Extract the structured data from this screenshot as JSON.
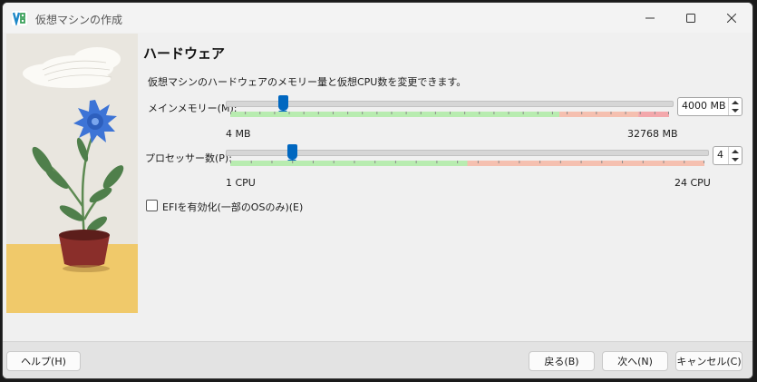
{
  "window": {
    "title": "仮想マシンの作成"
  },
  "page": {
    "heading": "ハードウェア",
    "description": "仮想マシンのハードウェアのメモリー量と仮想CPU数を変更できます。"
  },
  "memory": {
    "label": "メインメモリー(M):",
    "value": "4000 MB",
    "min_label": "4 MB",
    "max_label": "32768 MB",
    "fraction": 0.12,
    "green_fraction": 0.75,
    "salmon_fraction": 0.18,
    "pink_fraction": 0.07
  },
  "cpu": {
    "label": "プロセッサー数(P):",
    "value": "4",
    "min_label": "1 CPU",
    "max_label": "24 CPU",
    "fraction": 0.13,
    "green_fraction": 0.5,
    "salmon_fraction": 0.5
  },
  "efi": {
    "label": "EFIを有効化(一部のOSのみ)(E)",
    "checked": false
  },
  "buttons": {
    "help": "ヘルプ(H)",
    "back": "戻る(B)",
    "next": "次へ(N)",
    "cancel": "キャンセル(C)"
  },
  "colors": {
    "accent": "#0067c0",
    "green": "#b8ecb0",
    "salmon": "#f5c0b0",
    "pink": "#f3a8ac"
  }
}
